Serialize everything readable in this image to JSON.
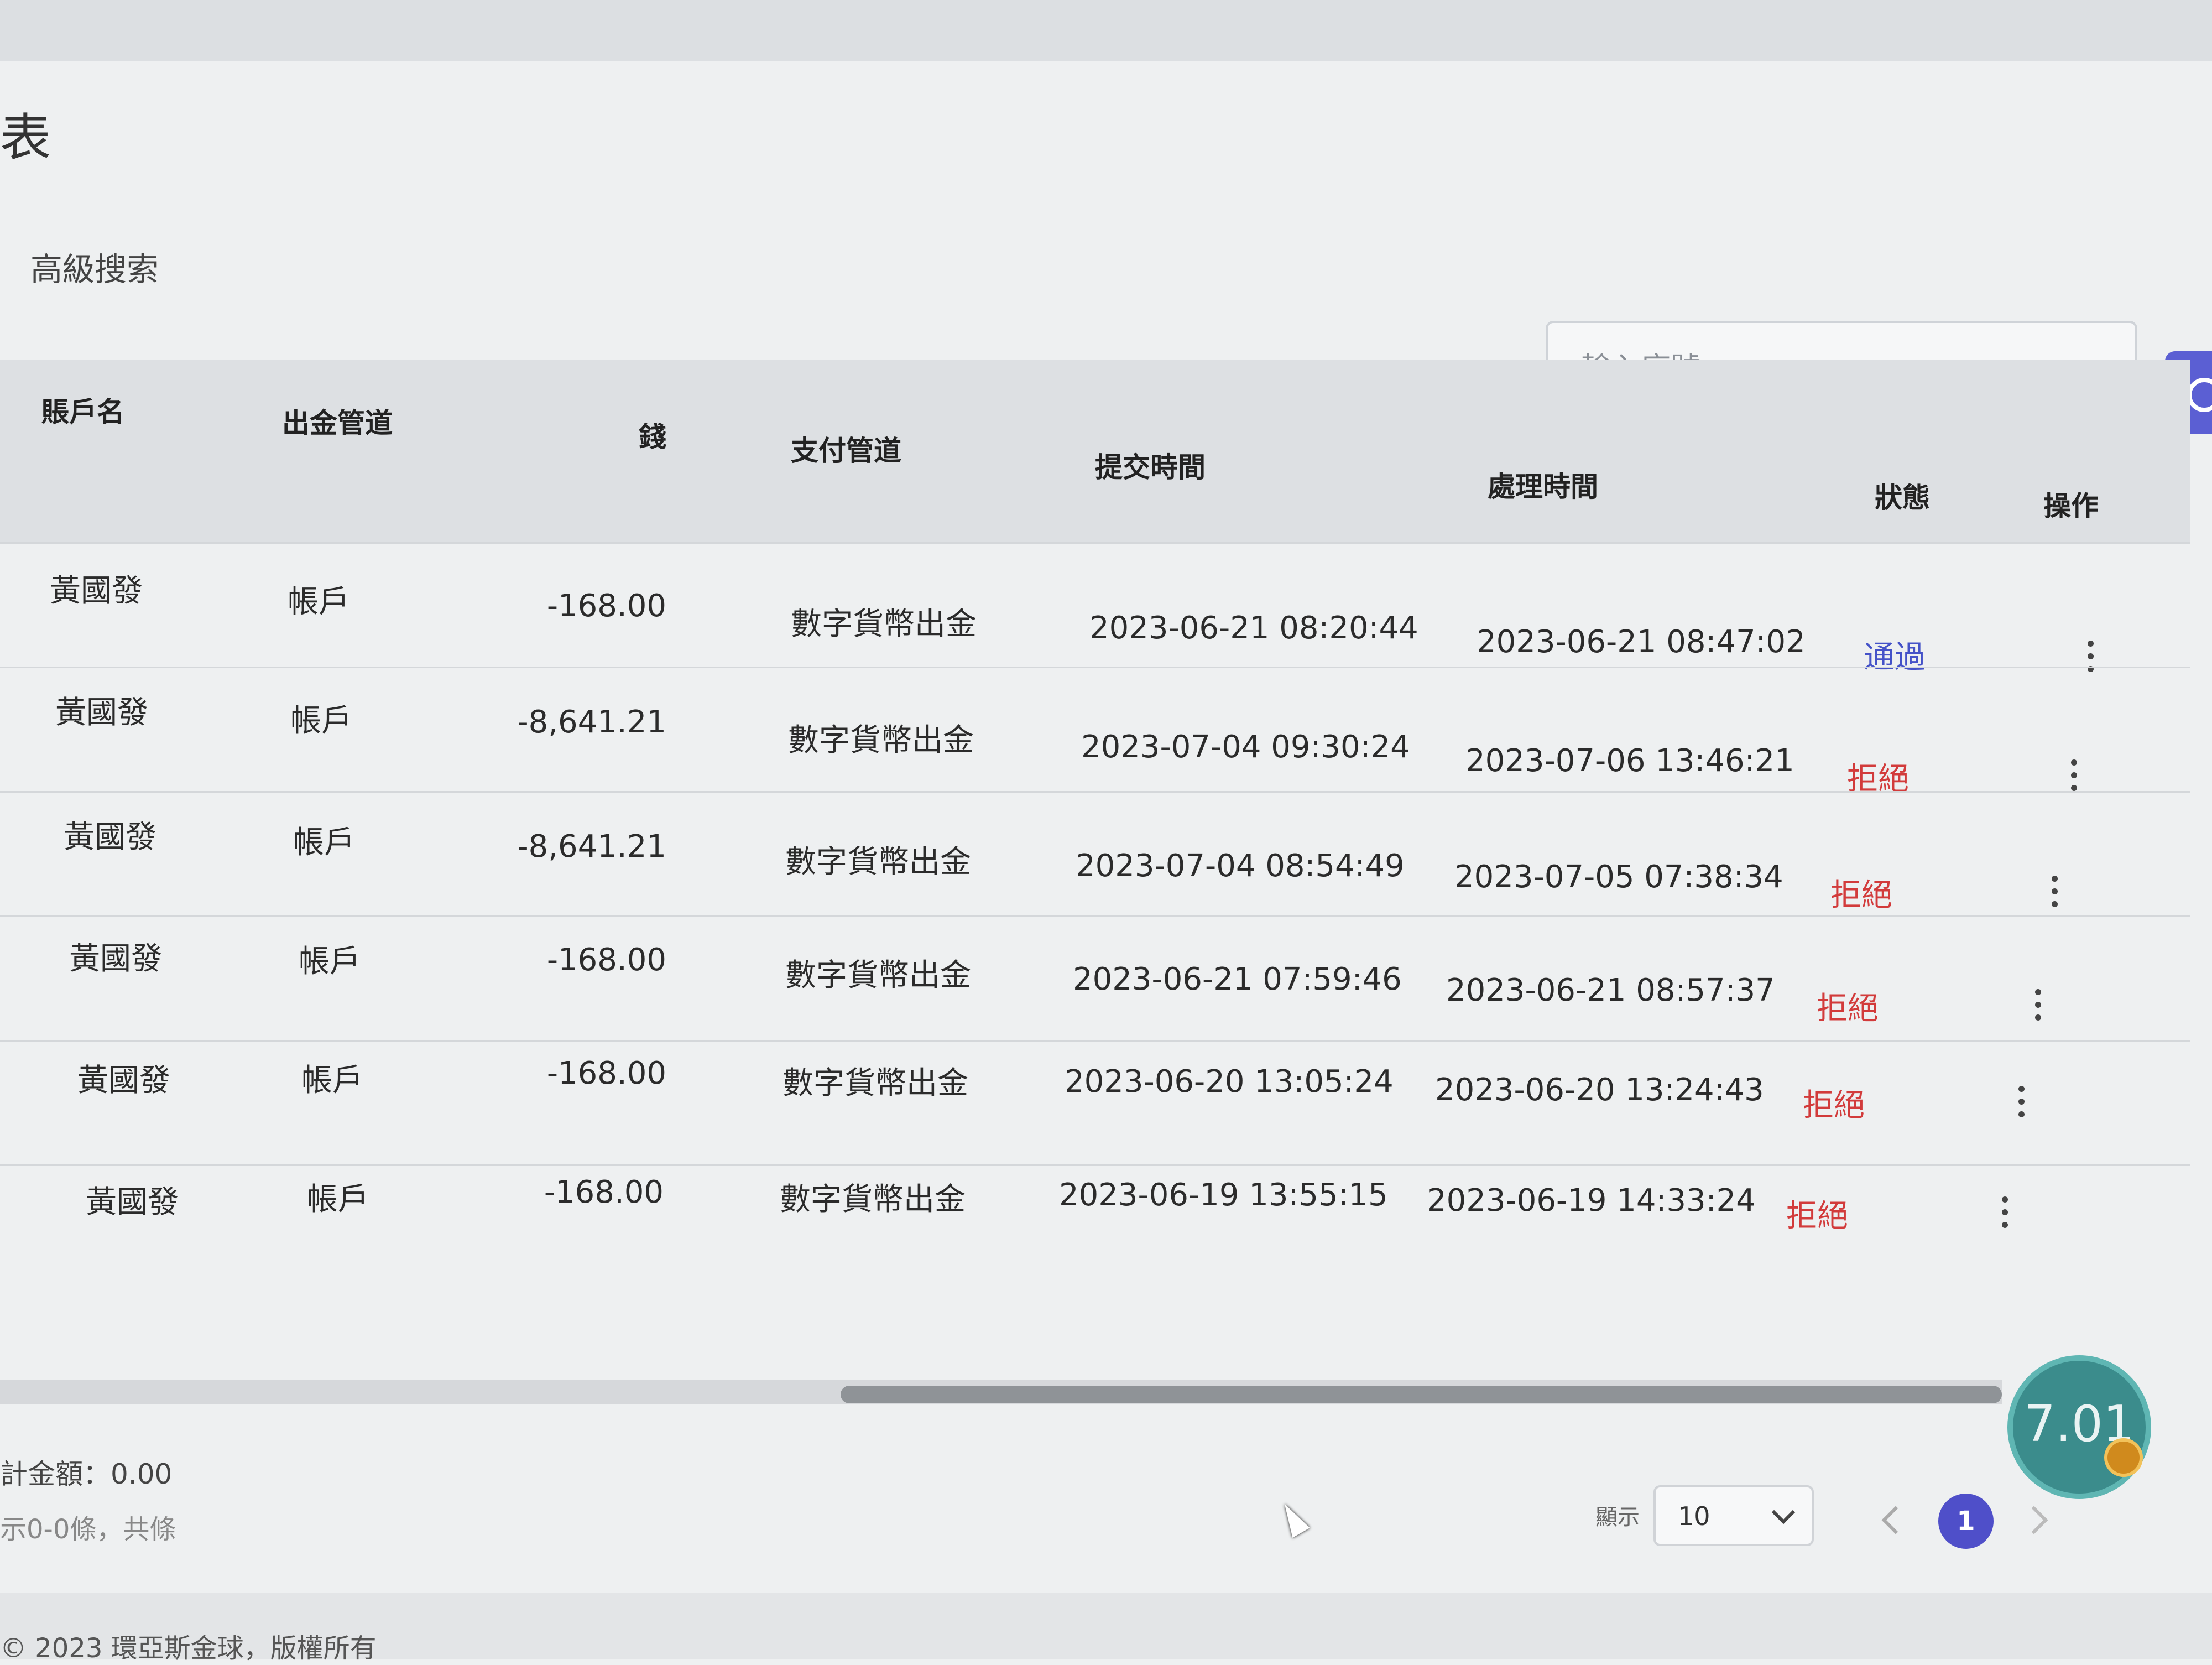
{
  "page": {
    "title": "表",
    "advanced_search": "高級搜索"
  },
  "search": {
    "placeholder": "輸入序號"
  },
  "table": {
    "columns": [
      "賬戶名",
      "出金管道",
      "錢",
      "支付管道",
      "提交時間",
      "處理時間",
      "狀態",
      "操作"
    ],
    "rows": [
      {
        "account": "黃國發",
        "channel": "帳戶",
        "amount": "-168.00",
        "payment": "數字貨幣出金",
        "submitted": "2023-06-21 08:20:44",
        "processed": "2023-06-21 08:47:02",
        "status": "通過"
      },
      {
        "account": "黃國發",
        "channel": "帳戶",
        "amount": "-8,641.21",
        "payment": "數字貨幣出金",
        "submitted": "2023-07-04 09:30:24",
        "processed": "2023-07-06 13:46:21",
        "status": "拒絕"
      },
      {
        "account": "黃國發",
        "channel": "帳戶",
        "amount": "-8,641.21",
        "payment": "數字貨幣出金",
        "submitted": "2023-07-04 08:54:49",
        "processed": "2023-07-05 07:38:34",
        "status": "拒絕"
      },
      {
        "account": "黃國發",
        "channel": "帳戶",
        "amount": "-168.00",
        "payment": "數字貨幣出金",
        "submitted": "2023-06-21 07:59:46",
        "processed": "2023-06-21 08:57:37",
        "status": "拒絕"
      },
      {
        "account": "黃國發",
        "channel": "帳戶",
        "amount": "-168.00",
        "payment": "數字貨幣出金",
        "submitted": "2023-06-20 13:05:24",
        "processed": "2023-06-20 13:24:43",
        "status": "拒絕"
      },
      {
        "account": "黃國發",
        "channel": "帳戶",
        "amount": "-168.00",
        "payment": "數字貨幣出金",
        "submitted": "2023-06-19 13:55:15",
        "processed": "2023-06-19 14:33:24",
        "status": "拒絕"
      }
    ]
  },
  "footer": {
    "total": "計金額：0.00",
    "count": "示0-0條，共條",
    "copyright": "© 2023 環亞斯金球，版權所有"
  },
  "pagination": {
    "page_size_label": "顯示",
    "page_size": "10",
    "current_page": "1"
  },
  "badge": {
    "score": "7.01"
  },
  "colors": {
    "pass": "#4452c8",
    "reject": "#d23b3b",
    "accent": "#5b5fd3"
  }
}
